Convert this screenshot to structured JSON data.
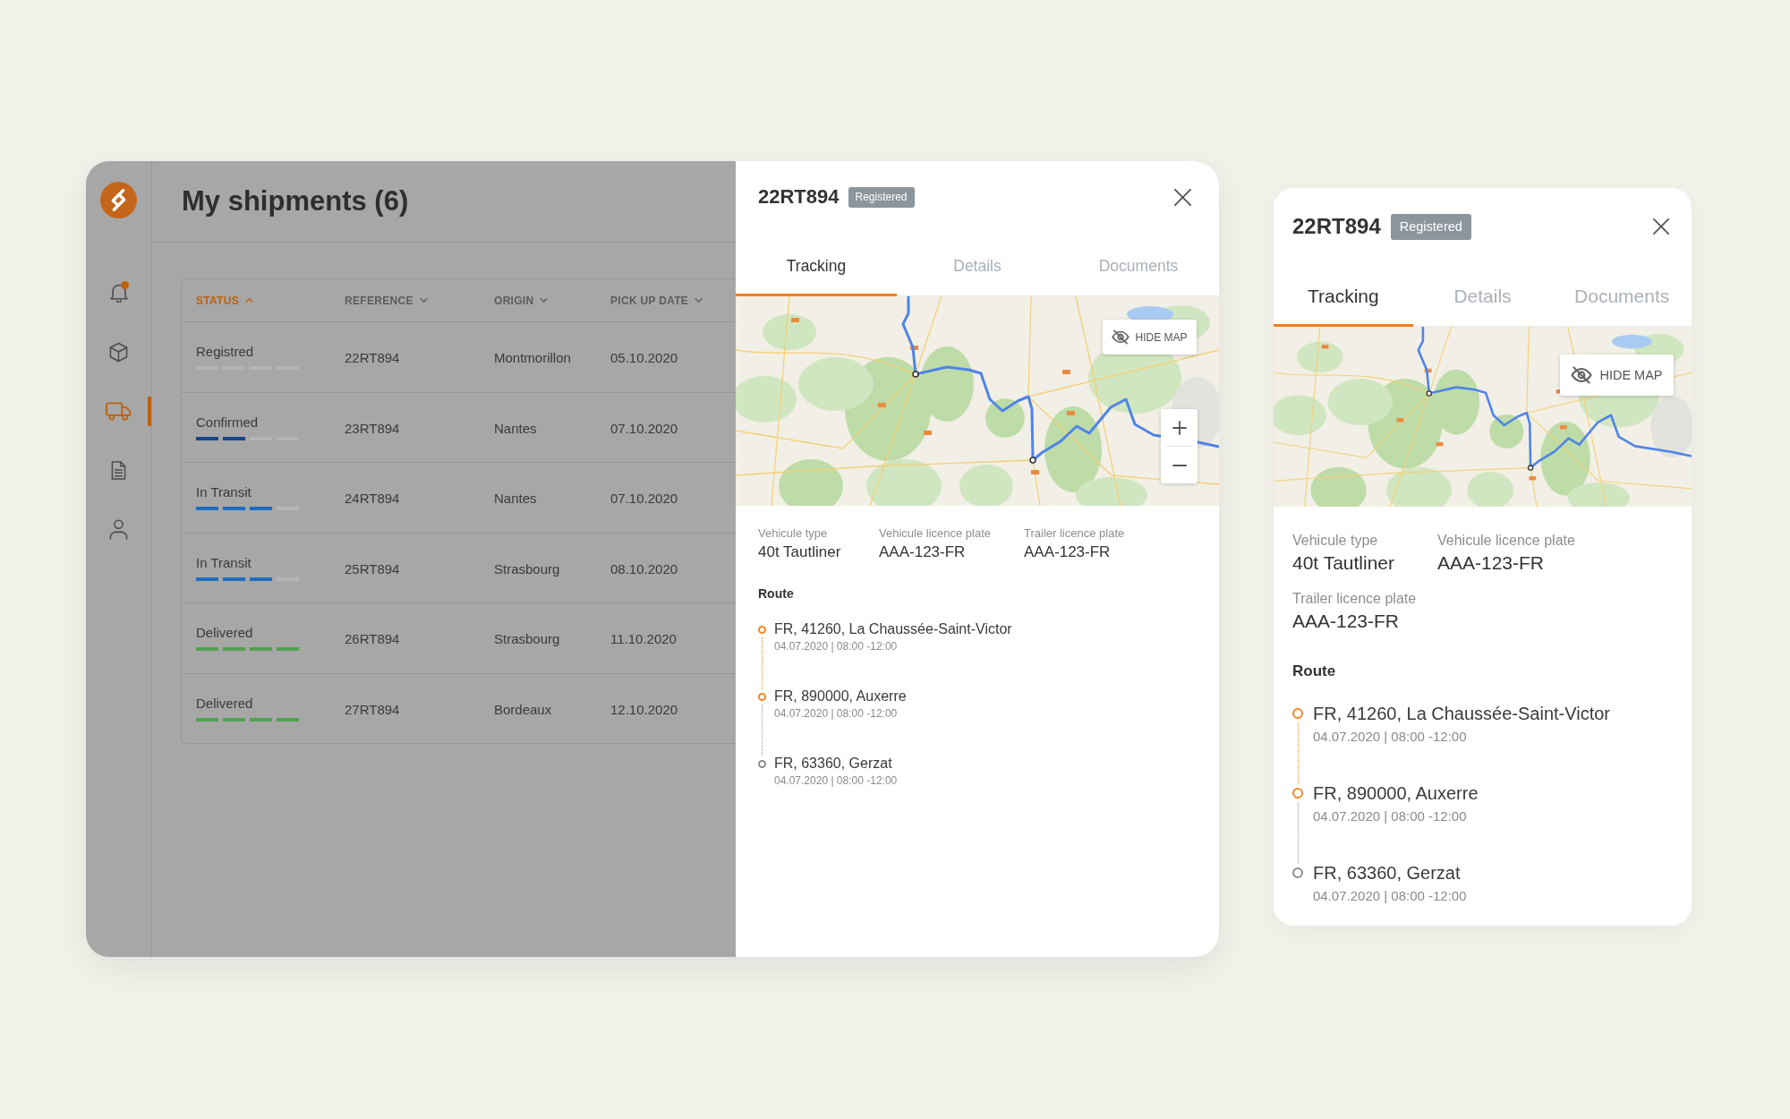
{
  "sidebar": {
    "items": [
      {
        "kind": "bell",
        "selected": false,
        "notification": true
      },
      {
        "kind": "box",
        "selected": false,
        "notification": false
      },
      {
        "kind": "truck",
        "selected": true,
        "notification": false
      },
      {
        "kind": "document",
        "selected": false,
        "notification": false
      },
      {
        "kind": "user",
        "selected": false,
        "notification": false
      }
    ]
  },
  "header": {
    "title": "My shipments (6)"
  },
  "table": {
    "columns": [
      {
        "label": "STATUS",
        "active": true,
        "ascending": true
      },
      {
        "label": "REFERENCE",
        "active": false,
        "ascending": false
      },
      {
        "label": "ORIGIN",
        "active": false,
        "ascending": false
      },
      {
        "label": "PICK UP DATE",
        "active": false,
        "ascending": false
      }
    ],
    "rows": [
      {
        "status": "Registred",
        "level": 0,
        "reference": "22RT894",
        "origin": "Montmorillon",
        "pickup_date": "05.10.2020"
      },
      {
        "status": "Confirmed",
        "level": 0.5,
        "color": "#14458c",
        "reference": "23RT894",
        "origin": "Nantes",
        "pickup_date": "07.10.2020"
      },
      {
        "status": "In Transit",
        "level": 0.75,
        "color": "#1f6cc0",
        "reference": "24RT894",
        "origin": "Nantes",
        "pickup_date": "07.10.2020"
      },
      {
        "status": "In Transit",
        "level": 0.75,
        "color": "#1f6cc0",
        "reference": "25RT894",
        "origin": "Strasbourg",
        "pickup_date": "08.10.2020"
      },
      {
        "status": "Delivered",
        "level": 1,
        "color": "#52a052",
        "reference": "26RT894",
        "origin": "Strasbourg",
        "pickup_date": "11.10.2020"
      },
      {
        "status": "Delivered",
        "level": 1,
        "color": "#52a052",
        "reference": "27RT894",
        "origin": "Bordeaux",
        "pickup_date": "12.10.2020"
      }
    ]
  },
  "detail_panel": {
    "title": "22RT894",
    "badge": "Registered",
    "tabs": [
      {
        "label": "Tracking",
        "selected": true
      },
      {
        "label": "Details",
        "selected": false
      },
      {
        "label": "Documents",
        "selected": false
      }
    ],
    "map": {
      "hide_button": "HIDE MAP",
      "zoom_controls": true
    },
    "vehicle": [
      {
        "label": "Vehicule type",
        "value": "40t Tautliner"
      },
      {
        "label": "Vehicule licence plate",
        "value": "AAA-123-FR"
      },
      {
        "label": "Trailer licence plate",
        "value": "AAA-123-FR"
      }
    ],
    "route": {
      "title": "Route",
      "stops": [
        {
          "place": "FR, 41260, La Chaussée-Saint-Victor",
          "time": "04.07.2020 | 08:00 -12:00",
          "reached": true
        },
        {
          "place": "FR, 890000, Auxerre",
          "time": "04.07.2020 | 08:00 -12:00",
          "reached": true
        },
        {
          "place": "FR, 63360, Gerzat",
          "time": "04.07.2020 | 08:00 -12:00",
          "reached": false
        }
      ]
    }
  },
  "detail_card": {
    "title": "22RT894",
    "badge": "Registered",
    "tabs": [
      {
        "label": "Tracking",
        "selected": true
      },
      {
        "label": "Details",
        "selected": false
      },
      {
        "label": "Documents",
        "selected": false
      }
    ],
    "map": {
      "hide_button": "HIDE MAP"
    },
    "vehicle": [
      {
        "label": "Vehicule type",
        "value": "40t Tautliner"
      },
      {
        "label": "Vehicule licence plate",
        "value": "AAA-123-FR"
      },
      {
        "label": "Trailer licence plate",
        "value": "AAA-123-FR"
      }
    ],
    "route": {
      "title": "Route",
      "stops": [
        {
          "place": "FR, 41260, La Chaussée-Saint-Victor",
          "time": "04.07.2020 | 08:00 -12:00",
          "reached": true
        },
        {
          "place": "FR, 890000, Auxerre",
          "time": "04.07.2020 | 08:00 -12:00",
          "reached": true
        },
        {
          "place": "FR, 63360, Gerzat",
          "time": "04.07.2020 | 08:00 -12:00",
          "reached": false
        }
      ]
    }
  }
}
